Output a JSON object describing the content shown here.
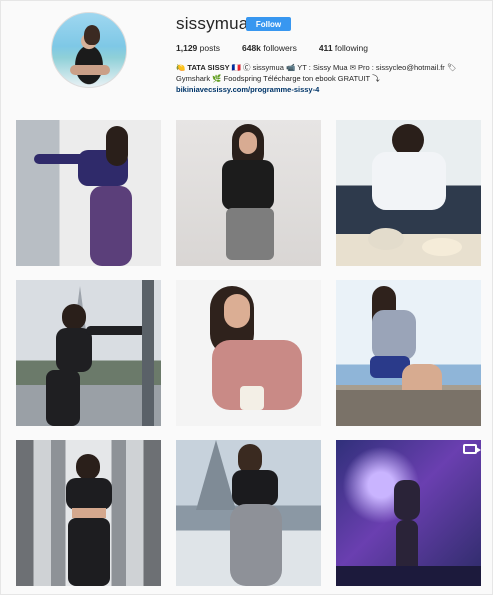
{
  "profile": {
    "username": "sissymua",
    "follow_label": "Follow",
    "stats": {
      "posts_count": "1,129",
      "posts_label": "posts",
      "followers_count": "648k",
      "followers_label": "followers",
      "following_count": "411",
      "following_label": "following"
    },
    "bio": {
      "line1_name": "🍋 TATA SISSY 🇫🇷",
      "line1_rest": "Ⓒ sissymua 📹 YT : Sissy Mua ✉ Pro : sissycleo@hotmail.fr 🏷",
      "line2": "Gymshark 🌿 Foodspring Télécharge ton ebook GRATUIT ⤵",
      "link": "bikiniavecsissy.com/programme-sissy-4"
    }
  },
  "posts": [
    {
      "id": "post-1",
      "subject": "woman in purple top stretching against window"
    },
    {
      "id": "post-2",
      "subject": "woman in black sheer top and grey skirt"
    },
    {
      "id": "post-3",
      "subject": "woman having breakfast at table"
    },
    {
      "id": "post-4",
      "subject": "woman in black outfit stretching near Eiffel Tower"
    },
    {
      "id": "post-5",
      "subject": "woman in pink top holding a cup"
    },
    {
      "id": "post-6",
      "subject": "woman sitting on rocks by the sea"
    },
    {
      "id": "post-7",
      "subject": "woman under bridge pillars"
    },
    {
      "id": "post-8",
      "subject": "woman in grey leggings near Eiffel Tower"
    },
    {
      "id": "post-9",
      "subject": "woman on stage with purple light",
      "video": true
    }
  ]
}
